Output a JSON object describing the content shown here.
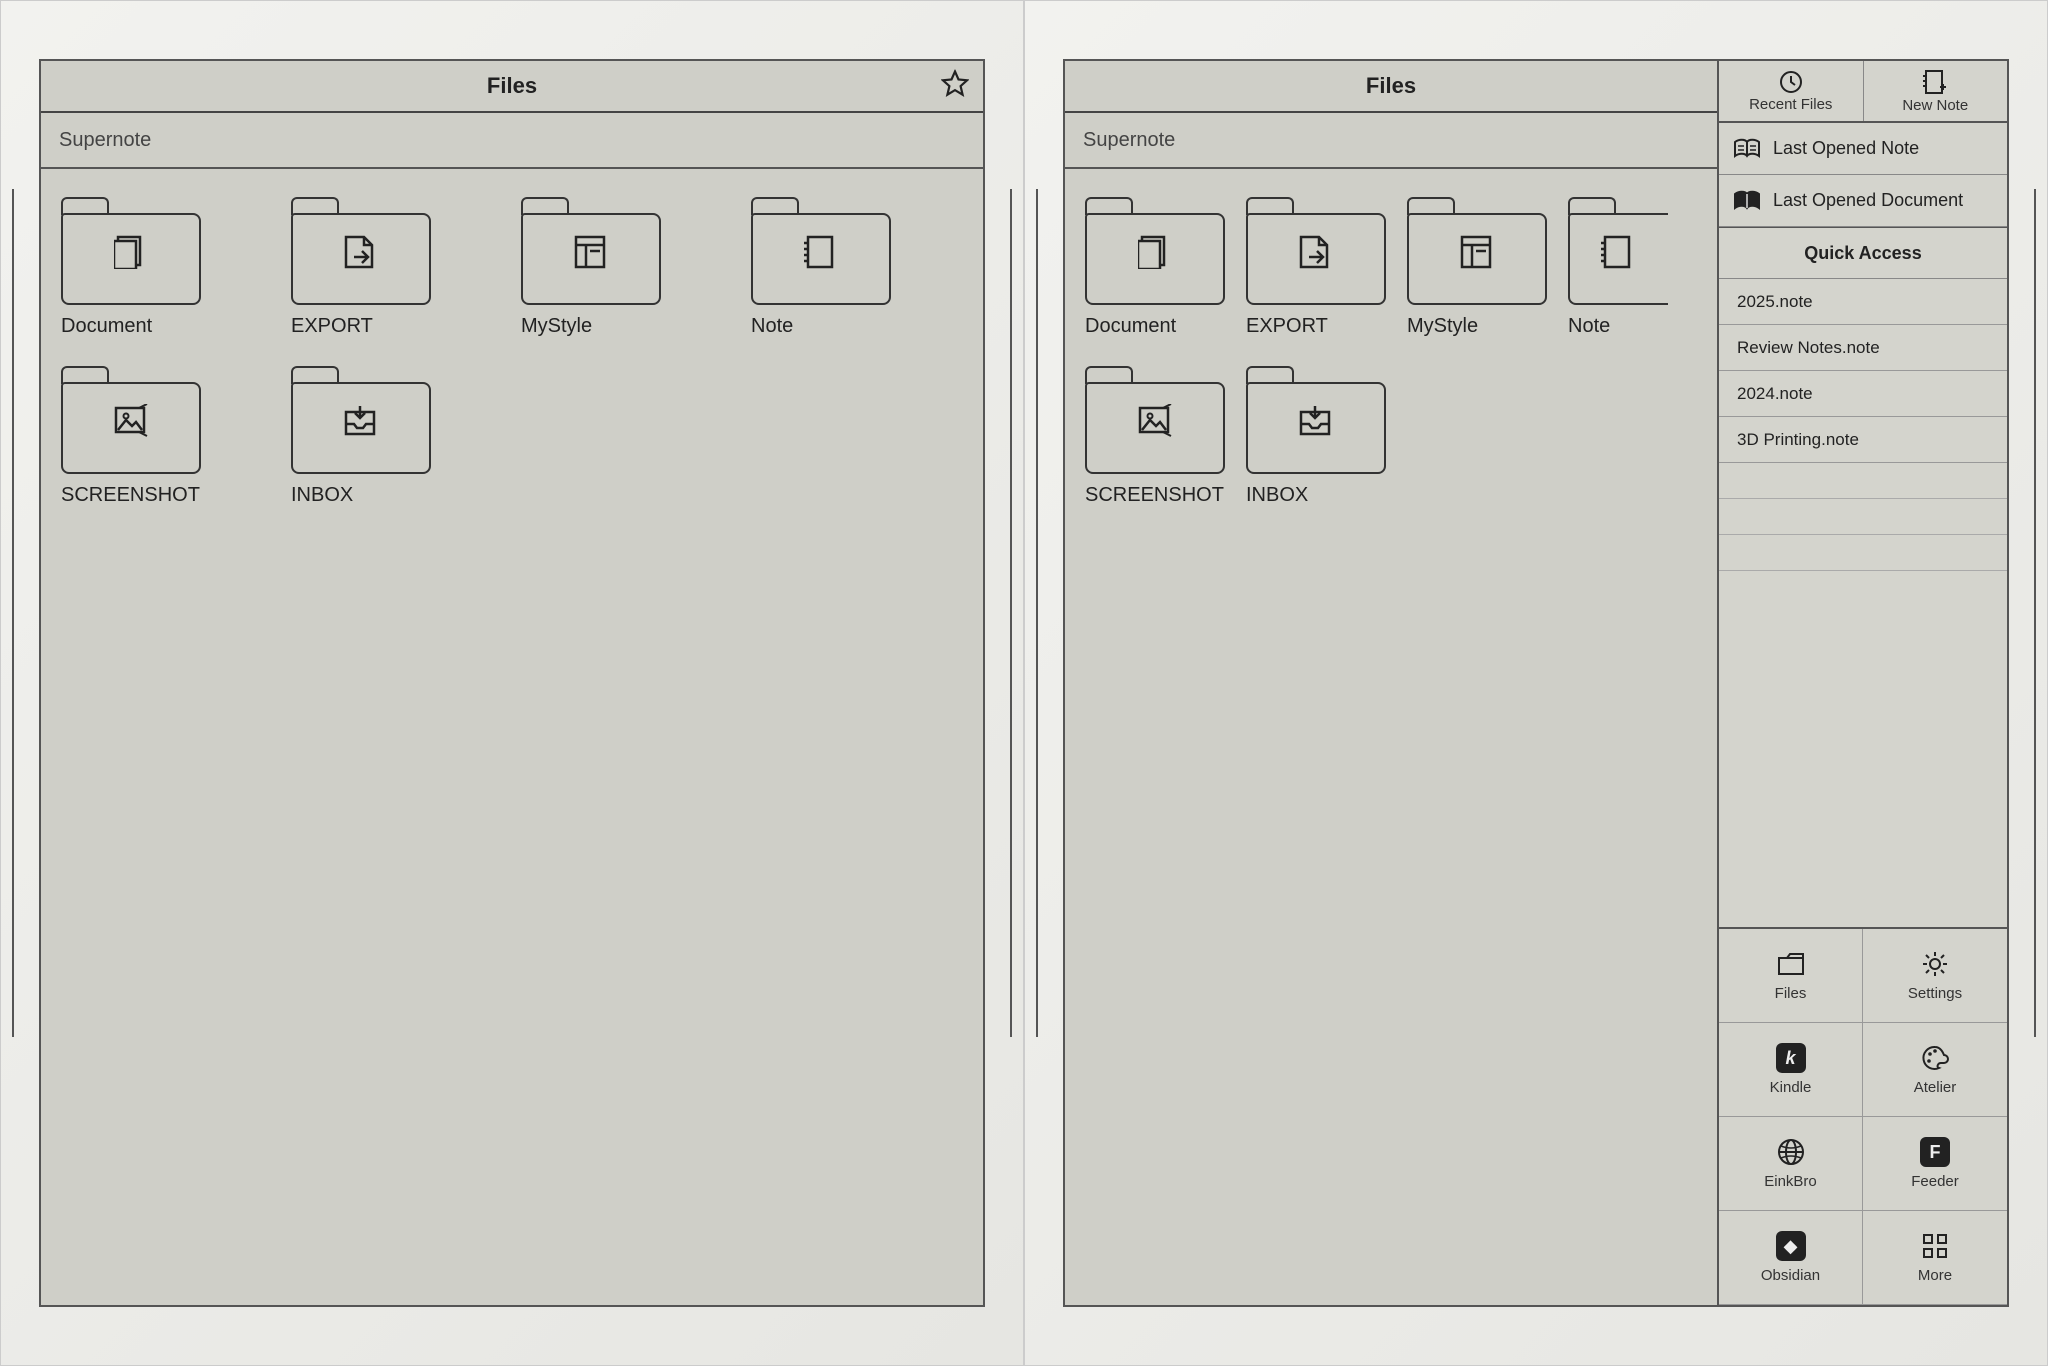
{
  "left": {
    "title": "Files",
    "breadcrumb": "Supernote",
    "folders": [
      {
        "label": "Document",
        "icon": "document"
      },
      {
        "label": "EXPORT",
        "icon": "export"
      },
      {
        "label": "MyStyle",
        "icon": "style"
      },
      {
        "label": "Note",
        "icon": "note"
      },
      {
        "label": "SCREENSHOT",
        "icon": "image"
      },
      {
        "label": "INBOX",
        "icon": "inbox"
      }
    ]
  },
  "right": {
    "title": "Files",
    "breadcrumb": "Supernote",
    "folders": [
      {
        "label": "Document",
        "icon": "document"
      },
      {
        "label": "EXPORT",
        "icon": "export"
      },
      {
        "label": "MyStyle",
        "icon": "style"
      },
      {
        "label": "Note",
        "icon": "note"
      },
      {
        "label": "SCREENSHOT",
        "icon": "image"
      },
      {
        "label": "INBOX",
        "icon": "inbox"
      }
    ],
    "sidebar": {
      "top_actions": [
        {
          "label": "Recent Files"
        },
        {
          "label": "New Note"
        }
      ],
      "last_opened_note": "Last Opened Note",
      "last_opened_document": "Last Opened Document",
      "quick_access_header": "Quick Access",
      "quick_access": [
        "2025.note",
        "Review Notes.note",
        "2024.note",
        "3D Printing.note"
      ],
      "apps": [
        {
          "label": "Files",
          "icon": "folder"
        },
        {
          "label": "Settings",
          "icon": "gear"
        },
        {
          "label": "Kindle",
          "icon": "kindle"
        },
        {
          "label": "Atelier",
          "icon": "palette"
        },
        {
          "label": "EinkBro",
          "icon": "globe"
        },
        {
          "label": "Feeder",
          "icon": "feeder"
        },
        {
          "label": "Obsidian",
          "icon": "obsidian"
        },
        {
          "label": "More",
          "icon": "more"
        }
      ]
    }
  }
}
